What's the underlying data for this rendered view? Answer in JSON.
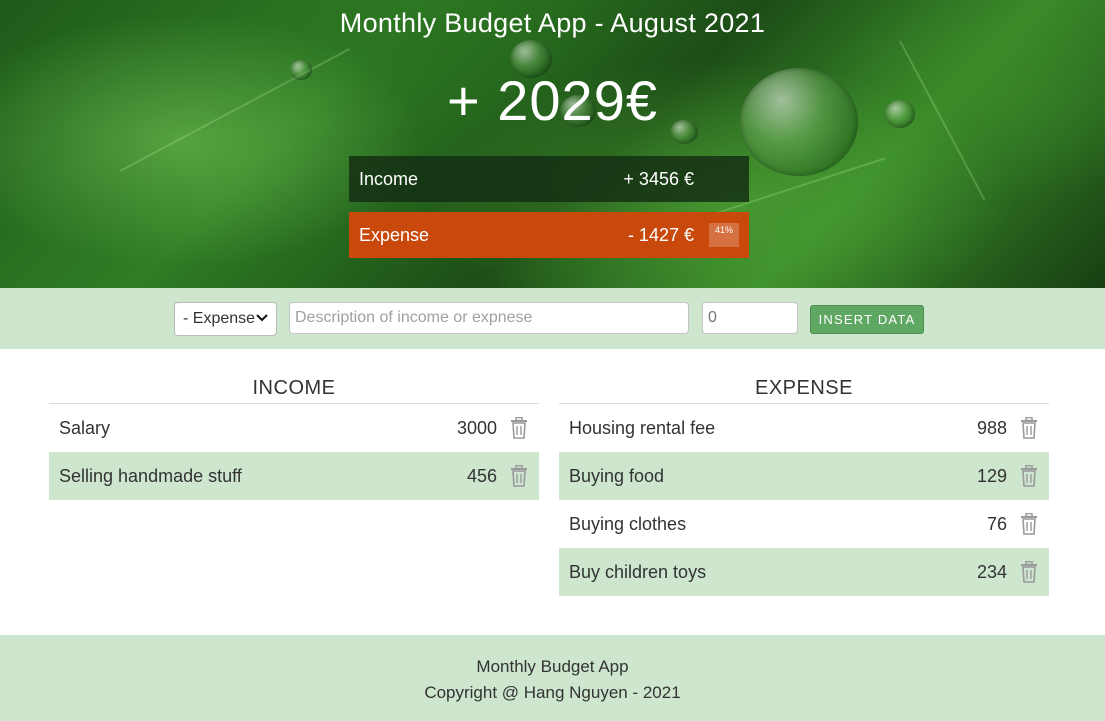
{
  "header": {
    "title": "Monthly Budget App - August 2021",
    "total": "+ 2029€",
    "income_label": "Income",
    "income_value": "+ 3456 €",
    "expense_label": "Expense",
    "expense_value": "- 1427 €",
    "expense_percent": "41%"
  },
  "input_bar": {
    "type_selected": "- Expense",
    "description_placeholder": "Description of income or expnese",
    "value_placeholder": "0",
    "insert_label": "INSERT DATA"
  },
  "income": {
    "title": "INCOME",
    "items": [
      {
        "description": "Salary",
        "value": "3000"
      },
      {
        "description": "Selling handmade stuff",
        "value": "456"
      }
    ]
  },
  "expense": {
    "title": "EXPENSE",
    "items": [
      {
        "description": "Housing rental fee",
        "value": "988"
      },
      {
        "description": "Buying food",
        "value": "129"
      },
      {
        "description": "Buying clothes",
        "value": "76"
      },
      {
        "description": "Buy children toys",
        "value": "234"
      }
    ]
  },
  "footer": {
    "line1": "Monthly Budget App",
    "line2": "Copyright @ Hang Nguyen - 2021"
  },
  "colors": {
    "accent_green": "#5fa863",
    "row_green": "#cde6cd",
    "expense_orange": "#c9480c",
    "income_dark": "#142d12"
  },
  "icons": {
    "delete": "trash-icon",
    "select": "chevron-down-icon"
  }
}
